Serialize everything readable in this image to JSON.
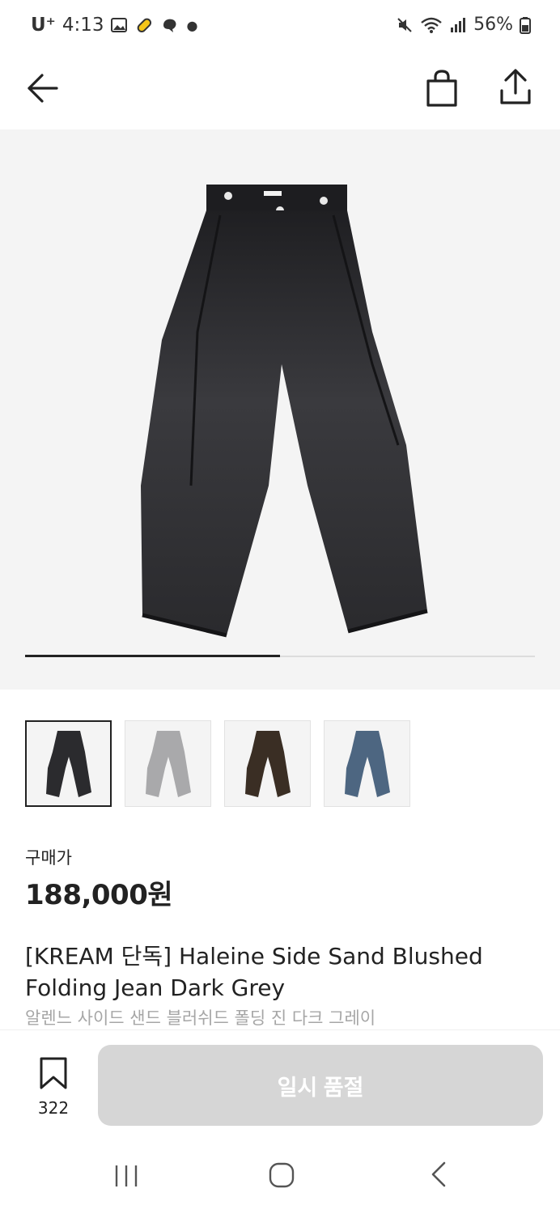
{
  "status_bar": {
    "carrier": "U⁺",
    "time": "4:13",
    "battery": "56%",
    "icons": [
      "gallery-icon",
      "pill-icon",
      "app-icon",
      "dot-icon",
      "mute-icon",
      "wifi-icon",
      "signal-icon",
      "battery-icon"
    ]
  },
  "app_bar": {
    "icons": [
      "back-arrow-icon",
      "shopping-bag-icon",
      "share-icon"
    ]
  },
  "gallery": {
    "image_index": 1,
    "image_count": 2,
    "thumbnail_colors": [
      "#2b2b2e",
      "#a9a9ab",
      "#3a2e24",
      "#4d6681"
    ]
  },
  "price": {
    "label": "구매가",
    "amount": "188,000원"
  },
  "product": {
    "title": "[KREAM 단독] Haleine Side Sand Blushed Folding Jean Dark Grey",
    "subtitle": "알렌느 사이드 샌드 블러쉬드 폴딩 진 다크 그레이"
  },
  "actions": {
    "bookmark_count": "322",
    "soldout_label": "일시 품절"
  },
  "colors": {
    "accent_dark": "#222222",
    "disabled_button": "#d6d6d6",
    "hero_bg": "#f4f4f4"
  }
}
